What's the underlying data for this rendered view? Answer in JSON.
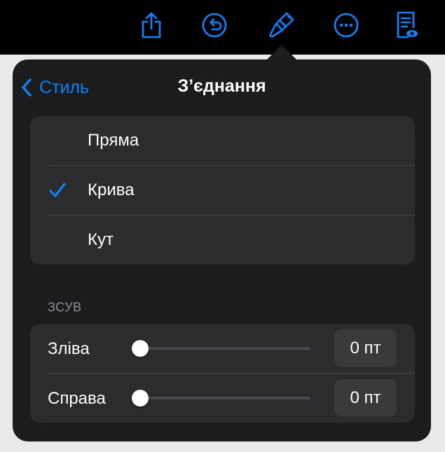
{
  "toolbar": {
    "icons": [
      "share-icon",
      "undo-icon",
      "paintbrush-icon",
      "more-icon",
      "reader-view-icon"
    ],
    "accent_color": "#0a84ff"
  },
  "popover": {
    "back_label": "Стиль",
    "title": "З’єднання",
    "options": [
      {
        "label": "Пряма",
        "selected": false
      },
      {
        "label": "Крива",
        "selected": true
      },
      {
        "label": "Кут",
        "selected": false
      }
    ],
    "offset_section": {
      "header": "ЗСУВ",
      "rows": [
        {
          "label": "Зліва",
          "value": "0 пт",
          "slider": 0
        },
        {
          "label": "Справа",
          "value": "0 пт",
          "slider": 0
        }
      ]
    }
  }
}
